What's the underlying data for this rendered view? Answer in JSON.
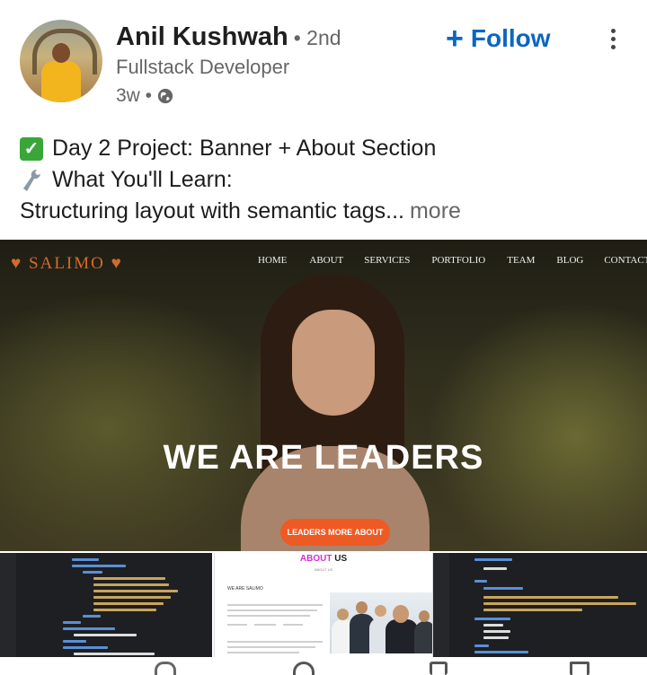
{
  "post": {
    "author": {
      "name": "Anil Kushwah",
      "degree": "• 2nd",
      "headline": "Fullstack Developer",
      "time": "3w •",
      "visibility_icon": "globe-icon"
    },
    "actions": {
      "follow_label": "Follow",
      "follow_icon": "plus-icon",
      "more_icon": "more-vertical-icon"
    },
    "text": {
      "line1_icon": "check-mark-icon",
      "line1": "Day 2 Project: Banner + About Section",
      "line2_icon": "wrench-icon",
      "line2": "What You'll Learn:",
      "line3": "Structuring layout with semantic tags...",
      "see_more": "more"
    }
  },
  "banner": {
    "logo": "SALIMO",
    "nav": [
      "HOME",
      "ABOUT",
      "SERVICES",
      "PORTFOLIO",
      "TEAM",
      "BLOG",
      "CONTACT"
    ],
    "title": "WE ARE LEADERS",
    "button_label": "LEADERS MORE ABOUT"
  },
  "thumbnails": {
    "about": {
      "title_accent": "ABOUT",
      "title_rest": "US",
      "subtitle": "ABOUT US",
      "heading": "WE ARE SALIMO"
    }
  },
  "colors": {
    "accent": "#0a66c2",
    "hero_button": "#ee5a24",
    "about_accent": "#d42fd4"
  }
}
